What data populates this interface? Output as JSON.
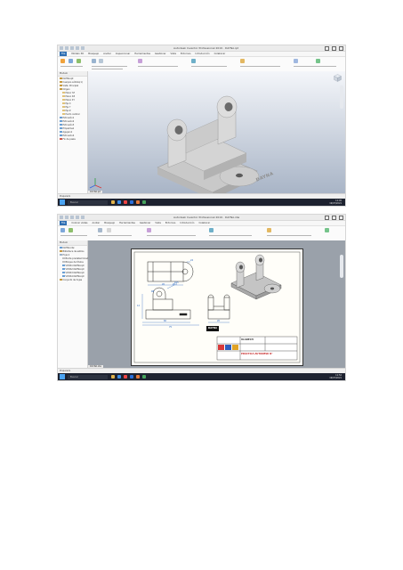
{
  "screens": [
    {
      "window_title": "Autodesk Inventor Professional 2019 · DAYNA.ipt",
      "tabs": [
        "File",
        "Modelo 3D",
        "Bosquejo",
        "Anotar",
        "Inspeccionar",
        "Herramientas",
        "Gestionar",
        "Vista",
        "Entornos",
        "Introducción",
        "Colaborar"
      ],
      "browser_title": "Modelo",
      "tree": [
        "DAYNA.ipt",
        "Cuerpos sólidos(1)",
        "Vista: Principal",
        "Origen",
        "Plano YZ",
        "Plano XZ",
        "Plano XY",
        "Eje X",
        "Eje Y",
        "Eje Z",
        "Punto central",
        "Extrusión1",
        "Extrusión2",
        "Extrusión3",
        "Empalme1",
        "Agujero1",
        "Extrusión4",
        "Fin de pieza"
      ],
      "model_label": "DAYNA",
      "doc_tab": "DAYNA.ipt",
      "status": "Preparado",
      "taskbar_search": "Buscar",
      "clock": {
        "time": "11:45",
        "date": "19/07/2021"
      }
    },
    {
      "window_title": "Autodesk Inventor Professional 2019 · DAYNA.idw",
      "tabs": [
        "File",
        "Colocar vistas",
        "Anotar",
        "Bosquejo",
        "Herramientas",
        "Gestionar",
        "Vista",
        "Entornos",
        "Introducción",
        "Colaborar"
      ],
      "browser_title": "Modelo",
      "tree": [
        "DAYNA.idw",
        "Biblioteca de estilos",
        "Hoja:1",
        "Borde predeterminado",
        "Bloque de títulos",
        "VISTA1:DAYNA.ipt",
        "VISTA2:DAYNA.ipt",
        "VISTA3:DAYNA.ipt",
        "VISTA4:DAYNA.ipt",
        "Conjunto de hojas"
      ],
      "title_block": {
        "company": "ULADECH",
        "drawing_title": "PRÁCTICA AUTODESK N°",
        "part_label": "DAYNA"
      },
      "dims": {
        "d1": "R15",
        "d2": "24",
        "d3": "Ø12",
        "d4": "45",
        "d5": "12",
        "d6": "60",
        "d7": "75",
        "d8": "20",
        "d9": "R8"
      },
      "doc_tab": "DAYNA.idw",
      "status": "Preparado",
      "taskbar_search": "Buscar",
      "clock": {
        "time": "11:52",
        "date": "19/07/2021"
      }
    }
  ],
  "colors": {
    "accent": "#2f6fb3",
    "viewport_top": "#f4f6fa",
    "viewport_bottom": "#a8b4c6",
    "taskbar": "#1d2230",
    "part_grey": "#c9c9c9"
  }
}
